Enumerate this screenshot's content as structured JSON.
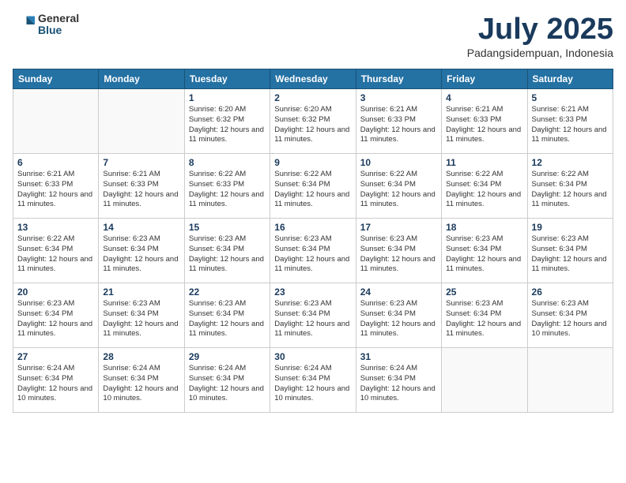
{
  "logo": {
    "general": "General",
    "blue": "Blue"
  },
  "header": {
    "month": "July 2025",
    "location": "Padangsidempuan, Indonesia"
  },
  "weekdays": [
    "Sunday",
    "Monday",
    "Tuesday",
    "Wednesday",
    "Thursday",
    "Friday",
    "Saturday"
  ],
  "weeks": [
    [
      {
        "day": "",
        "info": ""
      },
      {
        "day": "",
        "info": ""
      },
      {
        "day": "1",
        "info": "Sunrise: 6:20 AM\nSunset: 6:32 PM\nDaylight: 12 hours and 11 minutes."
      },
      {
        "day": "2",
        "info": "Sunrise: 6:20 AM\nSunset: 6:32 PM\nDaylight: 12 hours and 11 minutes."
      },
      {
        "day": "3",
        "info": "Sunrise: 6:21 AM\nSunset: 6:33 PM\nDaylight: 12 hours and 11 minutes."
      },
      {
        "day": "4",
        "info": "Sunrise: 6:21 AM\nSunset: 6:33 PM\nDaylight: 12 hours and 11 minutes."
      },
      {
        "day": "5",
        "info": "Sunrise: 6:21 AM\nSunset: 6:33 PM\nDaylight: 12 hours and 11 minutes."
      }
    ],
    [
      {
        "day": "6",
        "info": "Sunrise: 6:21 AM\nSunset: 6:33 PM\nDaylight: 12 hours and 11 minutes."
      },
      {
        "day": "7",
        "info": "Sunrise: 6:21 AM\nSunset: 6:33 PM\nDaylight: 12 hours and 11 minutes."
      },
      {
        "day": "8",
        "info": "Sunrise: 6:22 AM\nSunset: 6:33 PM\nDaylight: 12 hours and 11 minutes."
      },
      {
        "day": "9",
        "info": "Sunrise: 6:22 AM\nSunset: 6:34 PM\nDaylight: 12 hours and 11 minutes."
      },
      {
        "day": "10",
        "info": "Sunrise: 6:22 AM\nSunset: 6:34 PM\nDaylight: 12 hours and 11 minutes."
      },
      {
        "day": "11",
        "info": "Sunrise: 6:22 AM\nSunset: 6:34 PM\nDaylight: 12 hours and 11 minutes."
      },
      {
        "day": "12",
        "info": "Sunrise: 6:22 AM\nSunset: 6:34 PM\nDaylight: 12 hours and 11 minutes."
      }
    ],
    [
      {
        "day": "13",
        "info": "Sunrise: 6:22 AM\nSunset: 6:34 PM\nDaylight: 12 hours and 11 minutes."
      },
      {
        "day": "14",
        "info": "Sunrise: 6:23 AM\nSunset: 6:34 PM\nDaylight: 12 hours and 11 minutes."
      },
      {
        "day": "15",
        "info": "Sunrise: 6:23 AM\nSunset: 6:34 PM\nDaylight: 12 hours and 11 minutes."
      },
      {
        "day": "16",
        "info": "Sunrise: 6:23 AM\nSunset: 6:34 PM\nDaylight: 12 hours and 11 minutes."
      },
      {
        "day": "17",
        "info": "Sunrise: 6:23 AM\nSunset: 6:34 PM\nDaylight: 12 hours and 11 minutes."
      },
      {
        "day": "18",
        "info": "Sunrise: 6:23 AM\nSunset: 6:34 PM\nDaylight: 12 hours and 11 minutes."
      },
      {
        "day": "19",
        "info": "Sunrise: 6:23 AM\nSunset: 6:34 PM\nDaylight: 12 hours and 11 minutes."
      }
    ],
    [
      {
        "day": "20",
        "info": "Sunrise: 6:23 AM\nSunset: 6:34 PM\nDaylight: 12 hours and 11 minutes."
      },
      {
        "day": "21",
        "info": "Sunrise: 6:23 AM\nSunset: 6:34 PM\nDaylight: 12 hours and 11 minutes."
      },
      {
        "day": "22",
        "info": "Sunrise: 6:23 AM\nSunset: 6:34 PM\nDaylight: 12 hours and 11 minutes."
      },
      {
        "day": "23",
        "info": "Sunrise: 6:23 AM\nSunset: 6:34 PM\nDaylight: 12 hours and 11 minutes."
      },
      {
        "day": "24",
        "info": "Sunrise: 6:23 AM\nSunset: 6:34 PM\nDaylight: 12 hours and 11 minutes."
      },
      {
        "day": "25",
        "info": "Sunrise: 6:23 AM\nSunset: 6:34 PM\nDaylight: 12 hours and 11 minutes."
      },
      {
        "day": "26",
        "info": "Sunrise: 6:23 AM\nSunset: 6:34 PM\nDaylight: 12 hours and 10 minutes."
      }
    ],
    [
      {
        "day": "27",
        "info": "Sunrise: 6:24 AM\nSunset: 6:34 PM\nDaylight: 12 hours and 10 minutes."
      },
      {
        "day": "28",
        "info": "Sunrise: 6:24 AM\nSunset: 6:34 PM\nDaylight: 12 hours and 10 minutes."
      },
      {
        "day": "29",
        "info": "Sunrise: 6:24 AM\nSunset: 6:34 PM\nDaylight: 12 hours and 10 minutes."
      },
      {
        "day": "30",
        "info": "Sunrise: 6:24 AM\nSunset: 6:34 PM\nDaylight: 12 hours and 10 minutes."
      },
      {
        "day": "31",
        "info": "Sunrise: 6:24 AM\nSunset: 6:34 PM\nDaylight: 12 hours and 10 minutes."
      },
      {
        "day": "",
        "info": ""
      },
      {
        "day": "",
        "info": ""
      }
    ]
  ]
}
